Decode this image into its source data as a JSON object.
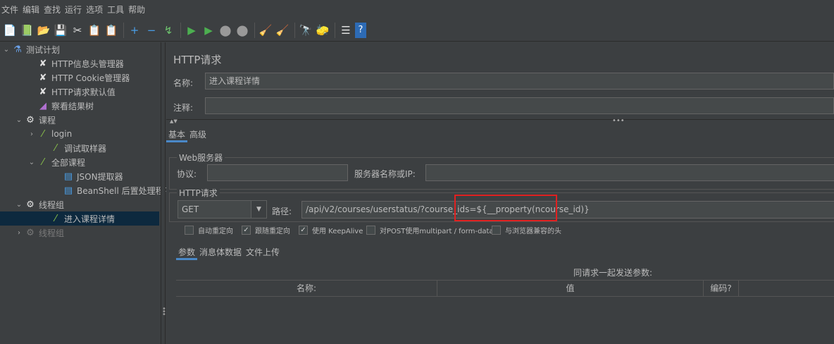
{
  "menu": [
    "文件",
    "编辑",
    "查找",
    "运行",
    "选项",
    "工具",
    "帮助"
  ],
  "toolbar": [
    {
      "icon": "new-icon",
      "glyph": "📄"
    },
    {
      "icon": "templates-icon",
      "glyph": "📗"
    },
    {
      "icon": "open-icon",
      "glyph": "📂"
    },
    {
      "icon": "save-icon",
      "glyph": "💾"
    },
    {
      "icon": "cut-icon",
      "glyph": "✂"
    },
    {
      "icon": "copy-icon",
      "glyph": "📋"
    },
    {
      "icon": "paste-icon",
      "glyph": "📋"
    },
    {
      "icon": "expand-icon",
      "glyph": "+"
    },
    {
      "icon": "collapse-icon",
      "glyph": "−"
    },
    {
      "icon": "toggle-icon",
      "glyph": "↯"
    },
    {
      "icon": "start-icon",
      "glyph": "▶"
    },
    {
      "icon": "start-no-pause-icon",
      "glyph": "▶"
    },
    {
      "icon": "stop-icon",
      "glyph": "⬤"
    },
    {
      "icon": "shutdown-icon",
      "glyph": "⬤"
    },
    {
      "icon": "clear-icon",
      "glyph": "🧹"
    },
    {
      "icon": "clear-all-icon",
      "glyph": "🧹"
    },
    {
      "icon": "search-icon",
      "glyph": "🔭"
    },
    {
      "icon": "reset-search-icon",
      "glyph": "🧽"
    },
    {
      "icon": "function-helper-icon",
      "glyph": "☰"
    },
    {
      "icon": "help-icon",
      "glyph": "?"
    }
  ],
  "tree": [
    {
      "label": "测试计划",
      "icon": "flask-icon",
      "glyph": "⚗",
      "arrow": "⌄",
      "depth": 0
    },
    {
      "label": "HTTP信息头管理器",
      "icon": "config-icon",
      "glyph": "✘",
      "arrow": "",
      "depth": 2
    },
    {
      "label": "HTTP Cookie管理器",
      "icon": "config-icon",
      "glyph": "✘",
      "arrow": "",
      "depth": 2
    },
    {
      "label": "HTTP请求默认值",
      "icon": "config-icon",
      "glyph": "✘",
      "arrow": "",
      "depth": 2
    },
    {
      "label": "察看结果树",
      "icon": "listener-icon",
      "glyph": "◢",
      "arrow": "",
      "depth": 2
    },
    {
      "label": "课程",
      "icon": "thread-group-icon",
      "glyph": "⚙",
      "arrow": "⌄",
      "depth": 1
    },
    {
      "label": "login",
      "icon": "sampler-icon",
      "glyph": "⁄",
      "arrow": "›",
      "depth": 2
    },
    {
      "label": "调试取样器",
      "icon": "sampler-icon",
      "glyph": "⁄",
      "arrow": "",
      "depth": 3
    },
    {
      "label": "全部课程",
      "icon": "sampler-icon",
      "glyph": "⁄",
      "arrow": "⌄",
      "depth": 2
    },
    {
      "label": "JSON提取器",
      "icon": "extractor-icon",
      "glyph": "▤",
      "arrow": "",
      "depth": 4
    },
    {
      "label": "BeanShell 后置处理程序",
      "icon": "extractor-icon",
      "glyph": "▤",
      "arrow": "",
      "depth": 4
    },
    {
      "label": "线程组",
      "icon": "thread-group-icon",
      "glyph": "⚙",
      "arrow": "⌄",
      "depth": 1
    },
    {
      "label": "进入课程详情",
      "icon": "sampler-icon",
      "glyph": "⁄",
      "arrow": "",
      "depth": 3,
      "selected": true
    },
    {
      "label": "线程组",
      "icon": "thread-group-icon",
      "glyph": "⚙",
      "arrow": "›",
      "depth": 1,
      "dim": true
    }
  ],
  "panel": {
    "title": "HTTP请求",
    "name_label": "名称:",
    "name_value": "进入课程详情",
    "comment_label": "注释:",
    "comment_value": "",
    "tabs": [
      "基本",
      "高级"
    ],
    "web_server": {
      "title": "Web服务器",
      "protocol_label": "协议:",
      "protocol_value": "",
      "server_label": "服务器名称或IP:",
      "server_value": ""
    },
    "http_request": {
      "title": "HTTP请求",
      "method": "GET",
      "path_label": "路径:",
      "path_value": "/api/v2/courses/userstatus/?course_ids=${__property(ncourse_id)}"
    },
    "checkboxes": [
      {
        "label": "自动重定向",
        "checked": false
      },
      {
        "label": "跟随重定向",
        "checked": true
      },
      {
        "label": "使用 KeepAlive",
        "checked": true
      },
      {
        "label": "对POST使用multipart / form-data",
        "checked": false
      },
      {
        "label": "与浏览器兼容的头",
        "checked": false
      }
    ],
    "param_tabs": [
      "参数",
      "消息体数据",
      "文件上传"
    ],
    "params_caption": "同请求一起发送参数:",
    "columns": [
      "名称:",
      "值",
      "编码?",
      ""
    ]
  },
  "colors": {
    "highlight_box": "#e02020",
    "selection": "#0d293e",
    "tab_underline": "#4a88c7"
  }
}
